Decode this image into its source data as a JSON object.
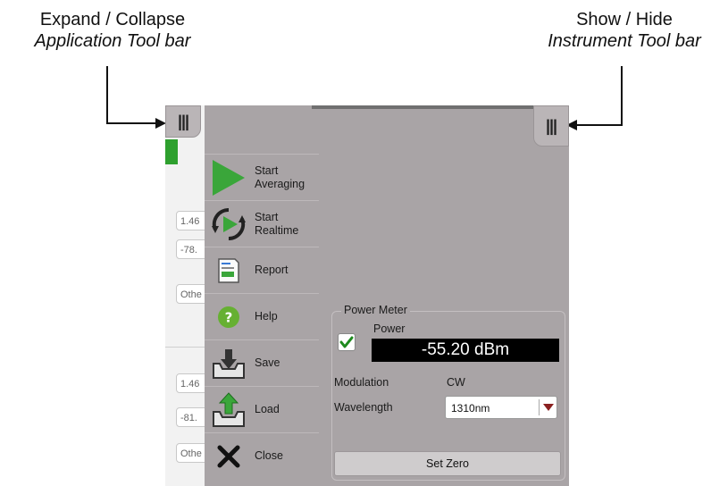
{
  "callouts": {
    "left_line1": "Expand / Collapse",
    "left_line2": "Application Tool bar",
    "right_line1": "Show / Hide",
    "right_line2": "Instrument Tool bar"
  },
  "background_fields": [
    "1.46",
    "-78.",
    "Othe",
    "1.46",
    "-81.",
    "Othe"
  ],
  "toolbar": {
    "items": [
      {
        "label": "Start Averaging",
        "icon": "play-triangle-icon"
      },
      {
        "label": "Start Realtime",
        "icon": "realtime-cycle-icon"
      },
      {
        "label": "Report",
        "icon": "report-document-icon"
      },
      {
        "label": "Help",
        "icon": "help-question-icon"
      },
      {
        "label": "Save",
        "icon": "save-tray-icon"
      },
      {
        "label": "Load",
        "icon": "load-tray-icon"
      },
      {
        "label": "Close",
        "icon": "close-x-icon"
      }
    ]
  },
  "power_meter": {
    "title": "Power Meter",
    "power_label": "Power",
    "power_checked": true,
    "reading": "-55.20 dBm",
    "modulation_label": "Modulation",
    "modulation_value": "CW",
    "wavelength_label": "Wavelength",
    "wavelength_value": "1310nm",
    "set_zero_label": "Set Zero"
  },
  "colors": {
    "panel_bg": "#a9a4a6",
    "accent_green": "#3aa63a",
    "help_green": "#66b032",
    "display_bg": "#000000",
    "caret_red": "#8a2020"
  }
}
